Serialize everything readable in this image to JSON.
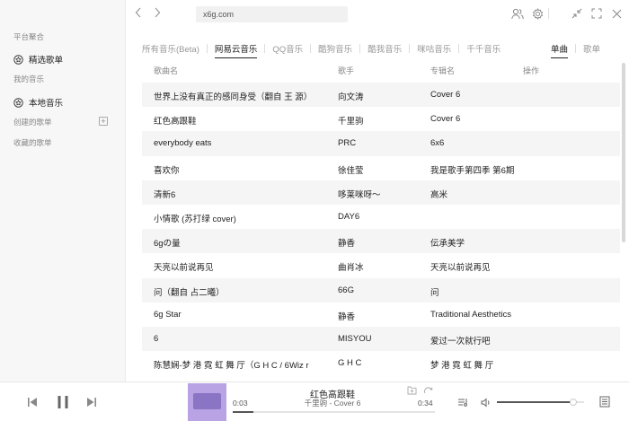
{
  "browser": {
    "url": "x6g.com"
  },
  "sidebar": {
    "section_platform": "平台聚合",
    "item_selected_playlists": "精选歌单",
    "section_my_music": "我的音乐",
    "item_local_music": "本地音乐",
    "created_playlists": "创建的歌单",
    "favorited_playlists": "收藏的歌单"
  },
  "tabs": [
    {
      "label": "所有音乐(Beta)",
      "active": false
    },
    {
      "label": "网易云音乐",
      "active": true
    },
    {
      "label": "QQ音乐",
      "active": false
    },
    {
      "label": "酷狗音乐",
      "active": false
    },
    {
      "label": "酷我音乐",
      "active": false
    },
    {
      "label": "咪咕音乐",
      "active": false
    },
    {
      "label": "千千音乐",
      "active": false
    }
  ],
  "right_tabs": [
    {
      "label": "单曲",
      "active": true
    },
    {
      "label": "歌单",
      "active": false
    }
  ],
  "table": {
    "headers": {
      "title": "歌曲名",
      "artist": "歌手",
      "album": "专辑名",
      "action": "操作"
    },
    "rows": [
      {
        "title": "世界上没有真正的感同身受（翻自 王 源）",
        "artist": "向文涛",
        "album": "Cover 6"
      },
      {
        "title": "红色高跟鞋",
        "artist": "千里驹",
        "album": "Cover 6"
      },
      {
        "title": "everybody eats",
        "artist": "PRC",
        "album": "6x6"
      },
      {
        "title": "喜欢你",
        "artist": "徐佳莹",
        "album": "我是歌手第四季 第6期"
      },
      {
        "title": "清新6",
        "artist": "哆莱咪呀～",
        "album": "高米"
      },
      {
        "title": "小情歌 (苏打绿 cover)",
        "artist": "DAY6",
        "album": ""
      },
      {
        "title": "6gの量",
        "artist": "静香",
        "album": "伝承美学"
      },
      {
        "title": "天亮以前说再见",
        "artist": "曲肖冰",
        "album": "天亮以前说再见"
      },
      {
        "title": "问（翻自 占二曦）",
        "artist": "66G",
        "album": "问"
      },
      {
        "title": "6g Star",
        "artist": "静香",
        "album": "Traditional Aesthetics"
      },
      {
        "title": "6",
        "artist": "MISYOU",
        "album": "爱过一次就行吧"
      },
      {
        "title": "陈慧娴-梦 港 霓 虹 舞 厅（G H C / 6Wiz r",
        "artist": "G H C",
        "album": "梦 港 霓 虹 舞 厅"
      }
    ]
  },
  "player": {
    "title": "红色高跟鞋",
    "subtitle": "千里驹 - Cover 6",
    "current_time": "0:03",
    "duration": "0:34",
    "progress": 0.1,
    "volume": 0.88
  },
  "colors": {
    "accent": "#222222",
    "cover": "#b9a3e4",
    "stripe": "#f5f5f5"
  }
}
